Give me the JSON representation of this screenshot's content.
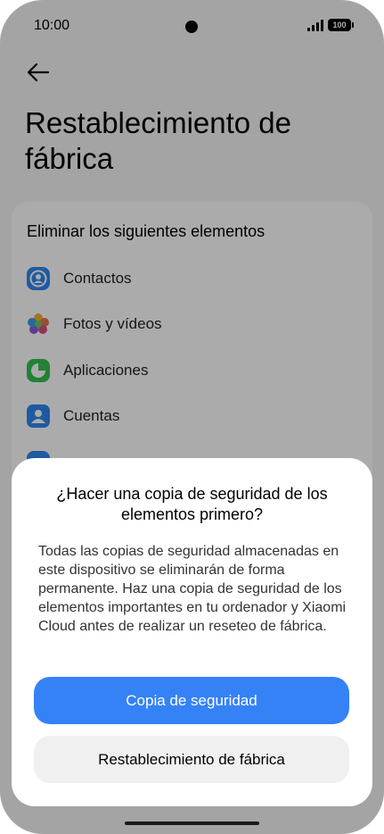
{
  "status_bar": {
    "time": "10:00",
    "battery": "100"
  },
  "page": {
    "title": "Restablecimiento de fábrica"
  },
  "card": {
    "heading": "Eliminar los siguientes elementos",
    "items": [
      {
        "label": "Contactos",
        "icon": "contacts-icon",
        "color": "#2f86f0"
      },
      {
        "label": "Fotos y vídeos",
        "icon": "photos-icon",
        "color": "#e5734a"
      },
      {
        "label": "Aplicaciones",
        "icon": "apps-icon",
        "color": "#32c153"
      },
      {
        "label": "Cuentas",
        "icon": "accounts-icon",
        "color": "#2f86f0"
      }
    ]
  },
  "dialog": {
    "title": "¿Hacer una copia de seguridad de los elementos primero?",
    "body": "Todas las copias de seguridad almacenadas en este dispositivo se eliminarán de forma permanente. Haz una copia de seguridad de los elementos importantes en tu ordenador y Xiaomi Cloud antes de realizar un reseteo de fábrica.",
    "primary_label": "Copia de seguridad",
    "secondary_label": "Restablecimiento de fábrica"
  },
  "colors": {
    "accent": "#3482f6",
    "overlay": "rgba(0,0,0,0.33)"
  }
}
